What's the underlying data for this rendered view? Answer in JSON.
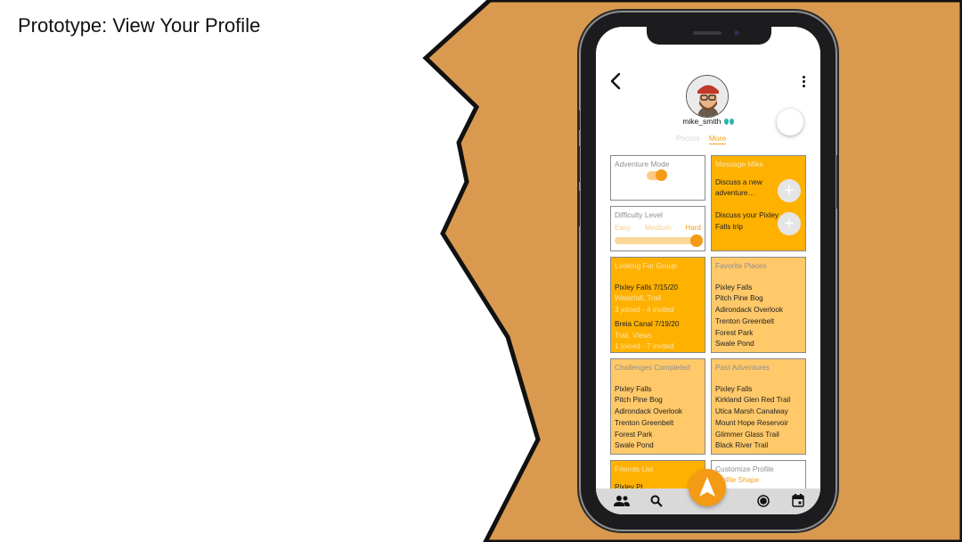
{
  "slide": {
    "title": "Prototype: View Your Profile"
  },
  "colors": {
    "background_orange": "#d99a50",
    "accent": "#f49a14",
    "card_orange": "#ffb100",
    "card_light": "#ffc869"
  },
  "profile": {
    "username": "mike_smith",
    "tabs": [
      "Photos",
      "More"
    ],
    "active_tab": "More"
  },
  "cards": {
    "adventure_mode": {
      "title": "Adventure Mode",
      "enabled": true
    },
    "difficulty": {
      "title": "Difficulty Level",
      "levels": [
        "Easy",
        "Medium",
        "Hard"
      ],
      "selected": "Hard",
      "level_fraction": 1.0
    },
    "message": {
      "title": "Message Mike",
      "items": [
        "Discuss a new adventure…",
        "Discuss your Pixley Falls trip"
      ]
    },
    "looking_for_group": {
      "title": "Looking For Group",
      "groups": [
        {
          "name": "Pixley Falls 7/15/20",
          "tags": "Waterfall, Trail",
          "status": "3 joined - 4 invited"
        },
        {
          "name": "Breia Canal 7/19/20",
          "tags": "Trail, Views",
          "status": "1 joined - 7 invited"
        }
      ]
    },
    "favorite_places": {
      "title": "Favorite Places",
      "items": [
        "Pixley Falls",
        "Pitch Pine Bog",
        "Adirondack Overlook",
        "Trenton Greenbelt",
        "Forest Park",
        "Swale Pond"
      ]
    },
    "challenges": {
      "title": "Challenges Completed",
      "items": [
        "Pixley Falls",
        "Pitch Pine Bog",
        "Adirondack Overlook",
        "Trenton Greenbelt",
        "Forest Park",
        "Swale Pond"
      ]
    },
    "past_adventures": {
      "title": "Past Adventures",
      "items": [
        "Pixley Falls",
        "Kirkland Glen Red Trail",
        "Utica Marsh Canalway",
        "Mount Hope Reservoir",
        "Glimmer Glass Trail",
        "Black River Trail"
      ]
    },
    "friends": {
      "title": "Friends List",
      "first_item": "Pixley Pl..."
    },
    "customize": {
      "title": "Customize Profile",
      "first_item": "Profile Shape"
    }
  },
  "nav": {
    "icons": [
      "friends-icon",
      "search-icon",
      "compass-icon",
      "record-icon",
      "calendar-icon"
    ]
  }
}
